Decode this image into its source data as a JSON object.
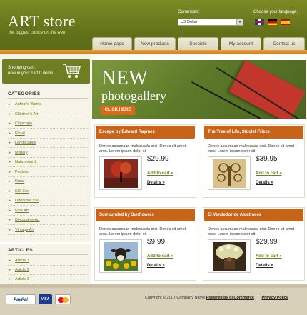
{
  "header": {
    "logo": "ART store",
    "tagline": "the biggest choice on the web",
    "currencies_label": "Currencies:",
    "currency_selected": "US Dollar",
    "language_label": "Choose your language:",
    "languages": [
      "uk-flag-icon",
      "germany-flag-icon",
      "spain-flag-icon"
    ]
  },
  "nav": {
    "items": [
      {
        "label": "Home page"
      },
      {
        "label": "New products"
      },
      {
        "label": "Specials"
      },
      {
        "label": "My account"
      },
      {
        "label": "Contact us"
      }
    ]
  },
  "cart": {
    "title": "Shopping cart:",
    "text": "now in your cart 0 items",
    "icon": "shopping-cart-icon"
  },
  "categories": {
    "heading": "CATEGORIES",
    "items": [
      "Author's Works",
      "Children's Art",
      "Cityscape",
      "Floral",
      "Landscapes",
      "Mistery",
      "Naturemord",
      "Posters",
      "Rural",
      "Still Life",
      "Offers for You",
      "Fine Art",
      "Decorative Art",
      "Vintage Art"
    ]
  },
  "articles": {
    "heading": "ARTICLES",
    "items": [
      "Article 1",
      "Article 2",
      "Article 3"
    ]
  },
  "banner": {
    "line1": "NEW",
    "line2": "photogallery",
    "button": "CLICK HERE"
  },
  "products": [
    {
      "title": "Escape by Edward Raymes",
      "desc": "Donec accumsan malesuada orci. Donec sit amet eros. Lorem ipsum dolor sit",
      "price": "$29.99",
      "add": "Add to cart",
      "details": "Details"
    },
    {
      "title": "The Tree of Life, Stoclet Frieze",
      "desc": "Donec accumsan malesuada orci. Donec sit amet eros. Lorem ipsum dolor sit",
      "price": "$39.95",
      "add": "Add to cart",
      "details": "Details"
    },
    {
      "title": "Surrounded by Sunflowers",
      "desc": "Donec accumsan malesuada orci. Donec sit amet eros. Lorem ipsum dolor sit",
      "price": "$9.99",
      "add": "Add to cart",
      "details": "Details"
    },
    {
      "title": "El Vendedor de Alcatraces",
      "desc": "Donec accumsan malesuada orci. Donec sit amet eros. Lorem ipsum dolor sit",
      "price": "$29.99",
      "add": "Add to cart",
      "details": "Details"
    }
  ],
  "footer": {
    "copyright": "Copyright © 2007 Company Name",
    "powered": "Powered by osCommerce",
    "privacy": "Privacy Policy",
    "separator": "|",
    "payment_paypal": "PayPal",
    "payment_visa": "VISA",
    "payment_icons": [
      "paypal-logo",
      "visa-logo",
      "mastercard-logo"
    ]
  },
  "colors": {
    "header_green": "#6f7e22",
    "accent_orange": "#c8641a",
    "sidebar_bg": "#f6f3e8",
    "footer_bg": "#d8d0b8"
  }
}
